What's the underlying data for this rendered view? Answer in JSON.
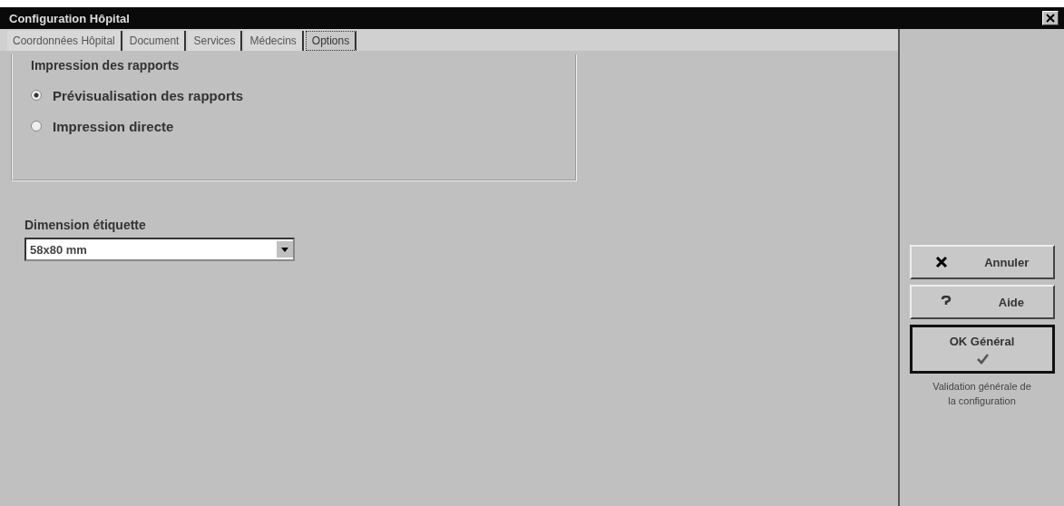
{
  "window": {
    "title": "Configuration Hôpital"
  },
  "tabs": [
    {
      "label": "Coordonnées Hôpital",
      "selected": false
    },
    {
      "label": "Document",
      "selected": false
    },
    {
      "label": "Services",
      "selected": false
    },
    {
      "label": "Médecins",
      "selected": false
    },
    {
      "label": "Options",
      "selected": true
    }
  ],
  "print_group": {
    "title": "Impression des rapports",
    "options": [
      {
        "label": "Prévisualisation des rapports",
        "selected": true
      },
      {
        "label": "Impression directe",
        "selected": false
      }
    ]
  },
  "label_size": {
    "label": "Dimension étiquette",
    "value": "58x80 mm"
  },
  "buttons": [
    {
      "kind": "cancel",
      "label": "Annuler"
    },
    {
      "kind": "help",
      "label": "Aide"
    },
    {
      "kind": "ok",
      "label": "OK Général"
    }
  ],
  "ok_hint": "Validation générale de la configuration"
}
